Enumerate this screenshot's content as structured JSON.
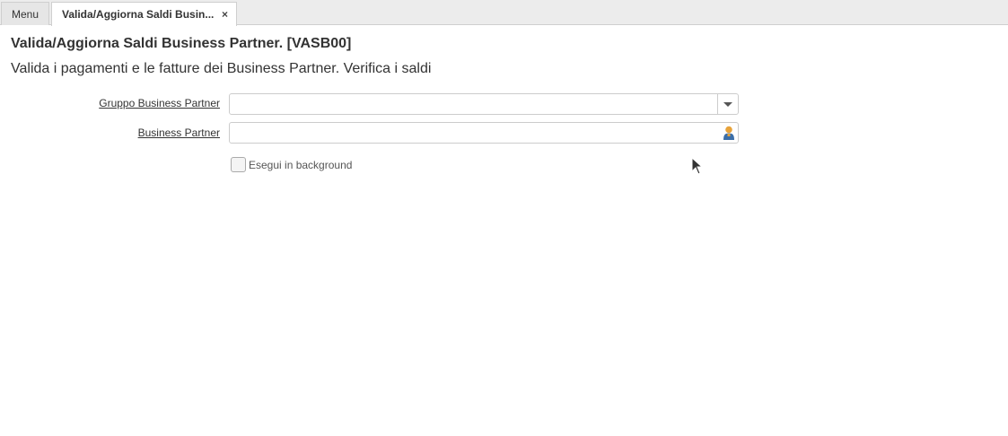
{
  "tabs": [
    {
      "label": "Menu"
    },
    {
      "label": "Valida/Aggiorna Saldi Busin...",
      "close_icon": "×"
    }
  ],
  "page": {
    "title": "Valida/Aggiorna Saldi Business Partner. [VASB00]",
    "description": "Valida i pagamenti e le fatture dei Business Partner. Verifica i saldi"
  },
  "fields": {
    "bp_group": {
      "label": "Gruppo Business Partner",
      "value": "",
      "icon": "chevron-down-icon"
    },
    "bp": {
      "label": "Business Partner",
      "value": "",
      "icon": "person-icon"
    }
  },
  "background": {
    "label": "Esegui in background",
    "checked": false
  },
  "colors": {
    "accent": "#e8a33a",
    "person_body": "#3b6ea8"
  }
}
